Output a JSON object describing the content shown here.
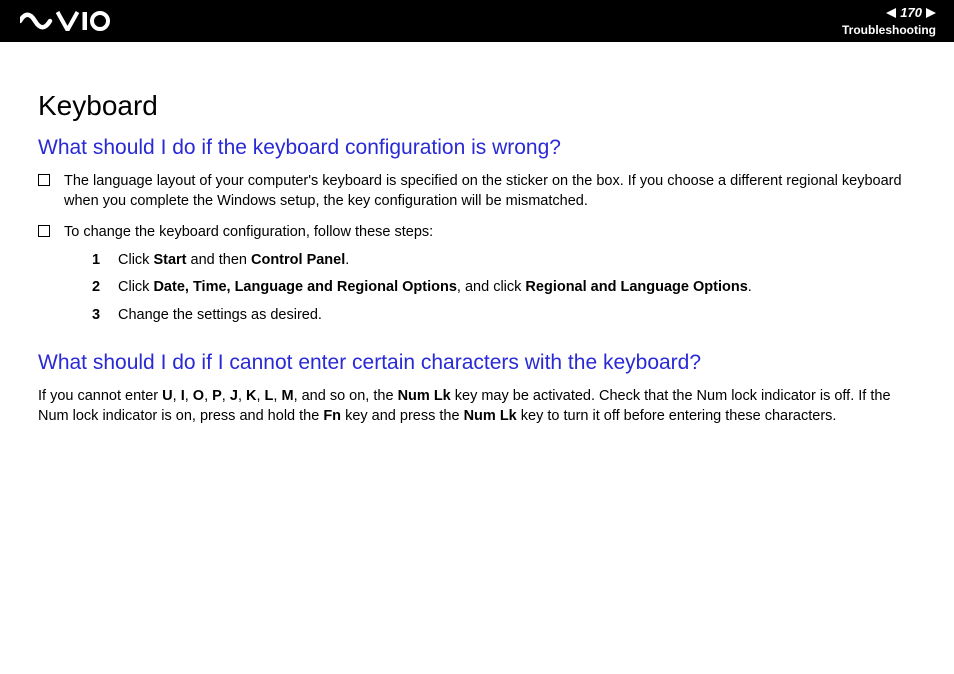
{
  "header": {
    "page_number": "170",
    "section": "Troubleshooting"
  },
  "main": {
    "title": "Keyboard",
    "q1": {
      "heading": "What should I do if the keyboard configuration is wrong?",
      "bullet1": "The language layout of your computer's keyboard is specified on the sticker on the box. If you choose a different regional keyboard when you complete the Windows setup, the key configuration will be mismatched.",
      "bullet2": "To change the keyboard configuration, follow these steps:",
      "steps": {
        "s1_pre": "Click ",
        "s1_b1": "Start",
        "s1_mid": " and then ",
        "s1_b2": "Control Panel",
        "s1_post": ".",
        "s2_pre": "Click ",
        "s2_b1": "Date, Time, Language and Regional Options",
        "s2_mid": ", and click ",
        "s2_b2": "Regional and Language Options",
        "s2_post": ".",
        "s3": "Change the settings as desired."
      }
    },
    "q2": {
      "heading": "What should I do if I cannot enter certain characters with the keyboard?",
      "p_pre": "If you cannot enter ",
      "p_u": "U",
      "p_c1": ", ",
      "p_i": "I",
      "p_c2": ", ",
      "p_o": "O",
      "p_c3": ", ",
      "p_p": "P",
      "p_c4": ", ",
      "p_j": "J",
      "p_c5": ", ",
      "p_k": "K",
      "p_c6": ", ",
      "p_l": "L",
      "p_c7": ", ",
      "p_m": "M",
      "p_mid1": ", and so on, the ",
      "p_numlk1": "Num Lk",
      "p_mid2": " key may be activated. Check that the Num lock indicator is off. If the Num lock indicator is on, press and hold the ",
      "p_fn": "Fn",
      "p_mid3": " key and press the ",
      "p_numlk2": "Num Lk",
      "p_post": " key to turn it off before entering these characters."
    }
  }
}
